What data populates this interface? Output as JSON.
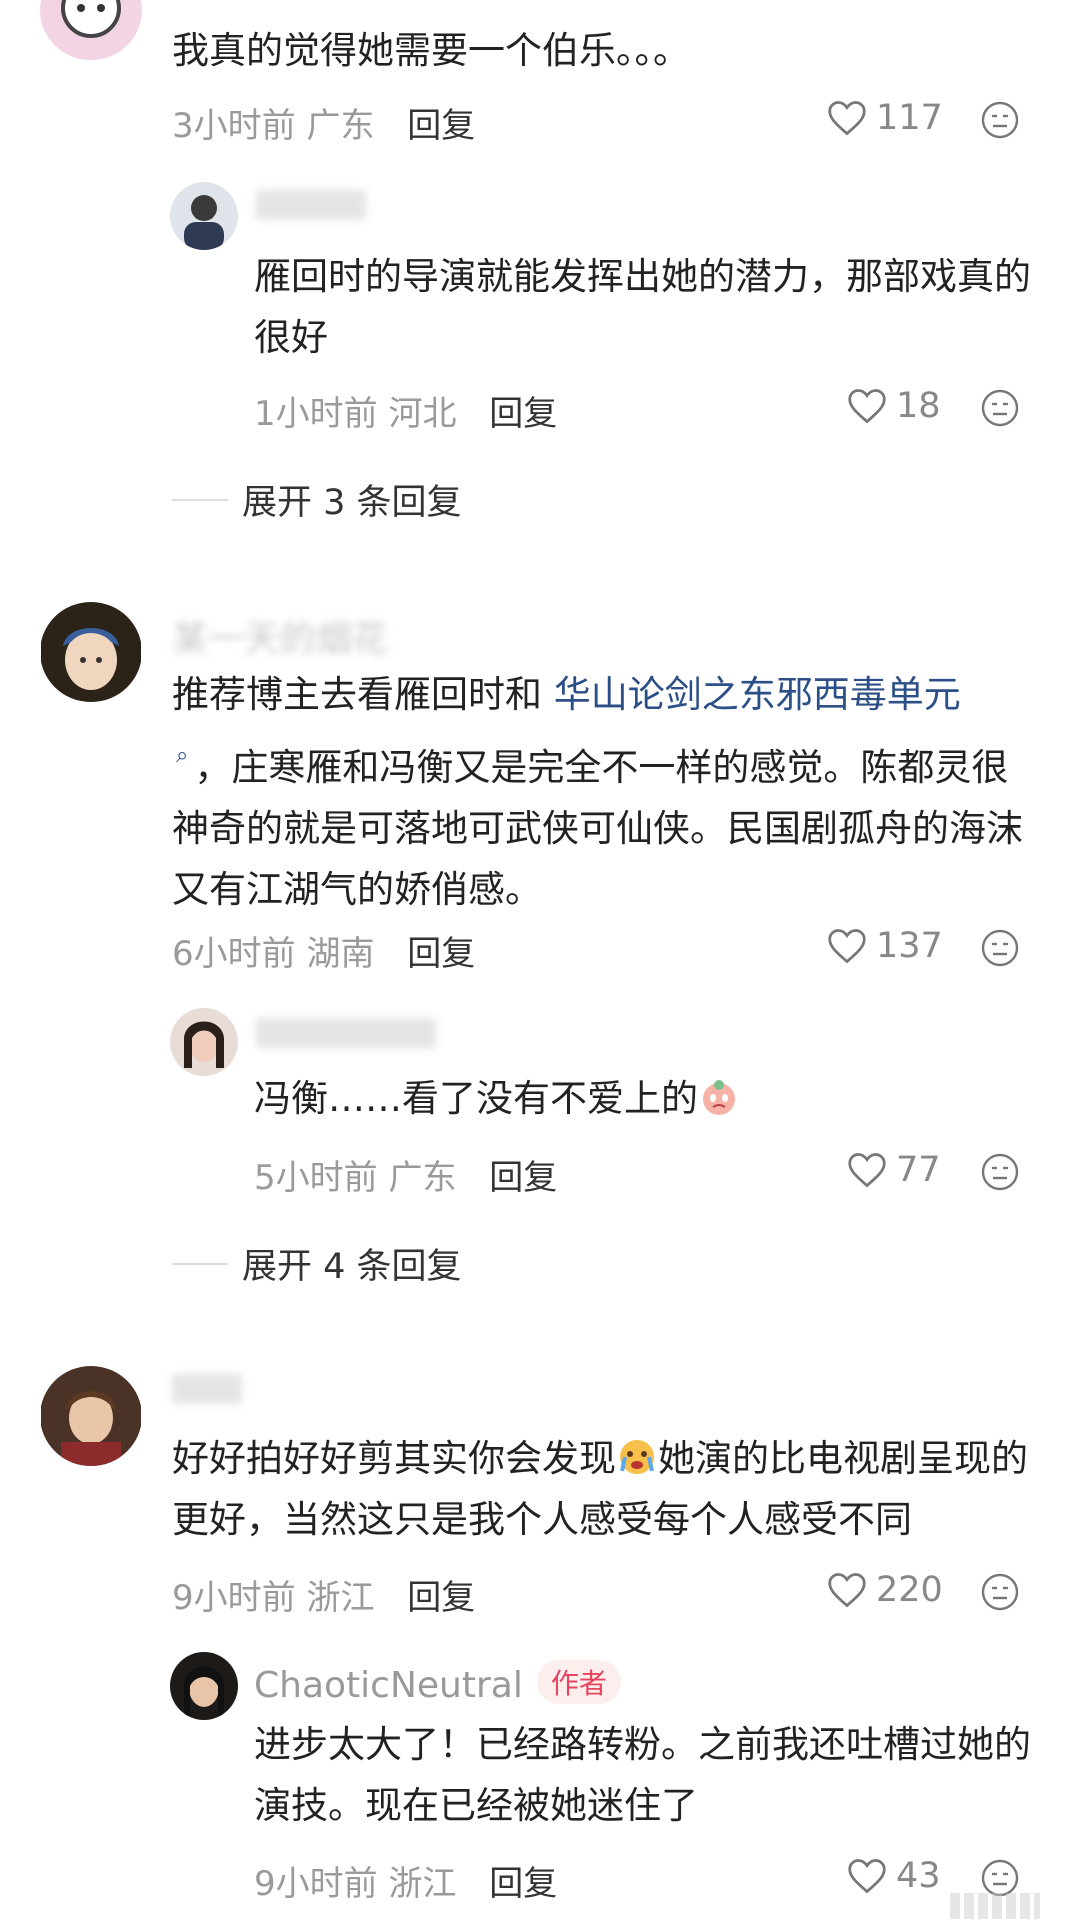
{
  "comments": [
    {
      "text": "我真的觉得她需要一个伯乐。。。",
      "time": "3小时前",
      "region": "广东",
      "reply": "回复",
      "likes": "117",
      "sub": {
        "text": "雁回时的导演就能发挥出她的潜力，那部戏真的很好",
        "time": "1小时前",
        "region": "河北",
        "reply": "回复",
        "likes": "18"
      },
      "expand": "展开 3 条回复"
    },
    {
      "name": "某一天的烟花",
      "text_a": "推荐博主去看雁回时和 ",
      "link": "华山论剑之东邪西毒单元",
      "text_b": "，庄寒雁和冯衡又是完全不一样的感觉。陈都灵很神奇的就是可落地可武侠可仙侠。民国剧孤舟的海沫又有江湖气的娇俏感。",
      "time": "6小时前",
      "region": "湖南",
      "reply": "回复",
      "likes": "137",
      "sub": {
        "text": "冯衡……看了没有不爱上的",
        "time": "5小时前",
        "region": "广东",
        "reply": "回复",
        "likes": "77"
      },
      "expand": "展开 4 条回复"
    },
    {
      "text_a": "好好拍好好剪其实你会发现",
      "text_b": "她演的比电视剧呈现的更好，当然这只是我个人感受每个人感受不同",
      "time": "9小时前",
      "region": "浙江",
      "reply": "回复",
      "likes": "220",
      "sub": {
        "name": "ChaoticNeutral",
        "badge": "作者",
        "text": "进步太大了！已经路转粉。之前我还吐槽过她的演技。现在已经被她迷住了",
        "time": "9小时前",
        "region": "浙江",
        "reply": "回复",
        "likes": "43"
      }
    }
  ],
  "colors": {
    "link": "#2b4f86",
    "badge_text": "#e5455f",
    "badge_bg": "#fdeeee"
  },
  "icons": [
    "heart-icon",
    "dislike-face-icon",
    "search-mark-icon",
    "crying-emoji-icon"
  ]
}
